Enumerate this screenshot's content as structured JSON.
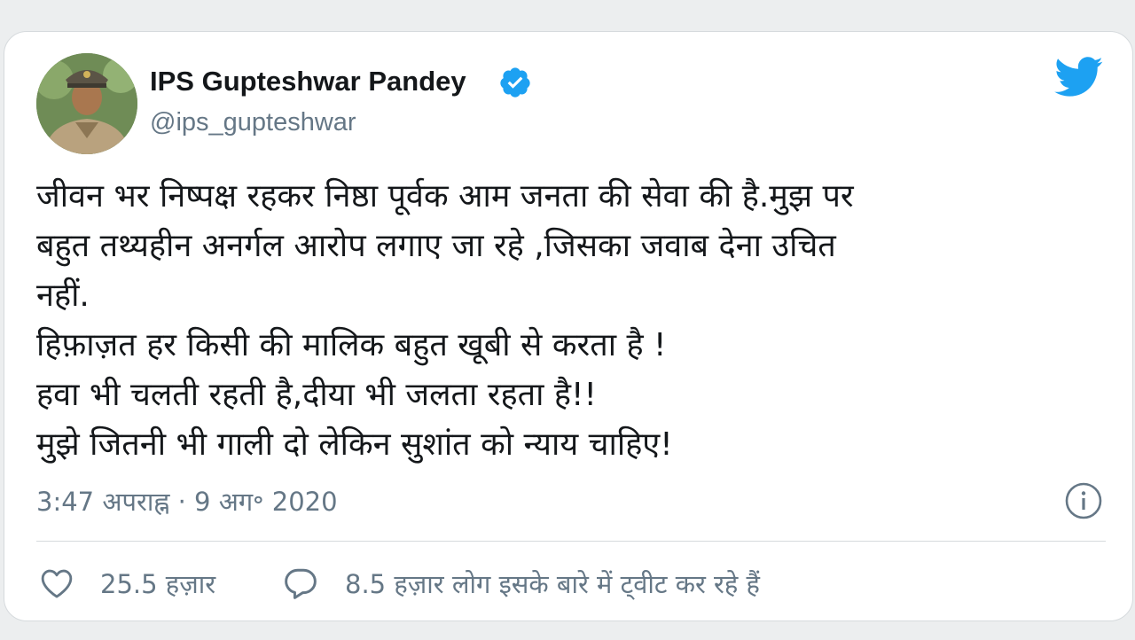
{
  "user": {
    "display_name": "IPS Gupteshwar Pandey",
    "handle": "@ips_gupteshwar",
    "verified": true
  },
  "tweet": {
    "lines": [
      "जीवन भर निष्पक्ष रहकर निष्ठा पूर्वक आम जनता की सेवा की है.मुझ पर",
      "बहुत तथ्यहीन अनर्गल आरोप लगाए जा रहे ,जिसका जवाब देना उचित",
      "नहीं.",
      "हिफ़ाज़त हर किसी की मालिक बहुत खूबी से करता है !",
      "हवा भी चलती रहती है,दीया भी जलता रहता है!!",
      "मुझे जितनी भी गाली दो लेकिन सुशांत को न्याय चाहिए!"
    ],
    "timestamp": "3:47 अपराह्न · 9 अग॰ 2020"
  },
  "actions": {
    "likes": "25.5 हज़ार",
    "conversation": "8.5 हज़ार लोग इसके बारे में ट्वीट कर रहे हैं"
  },
  "icons": {
    "brand": "twitter-bird-icon",
    "verified": "verified-badge-icon",
    "info": "info-icon",
    "like": "heart-icon",
    "reply": "speech-bubble-icon"
  },
  "colors": {
    "twitter_blue": "#1da1f2",
    "text_primary": "#14171a",
    "text_secondary": "#657786",
    "divider": "#d6dadd"
  }
}
